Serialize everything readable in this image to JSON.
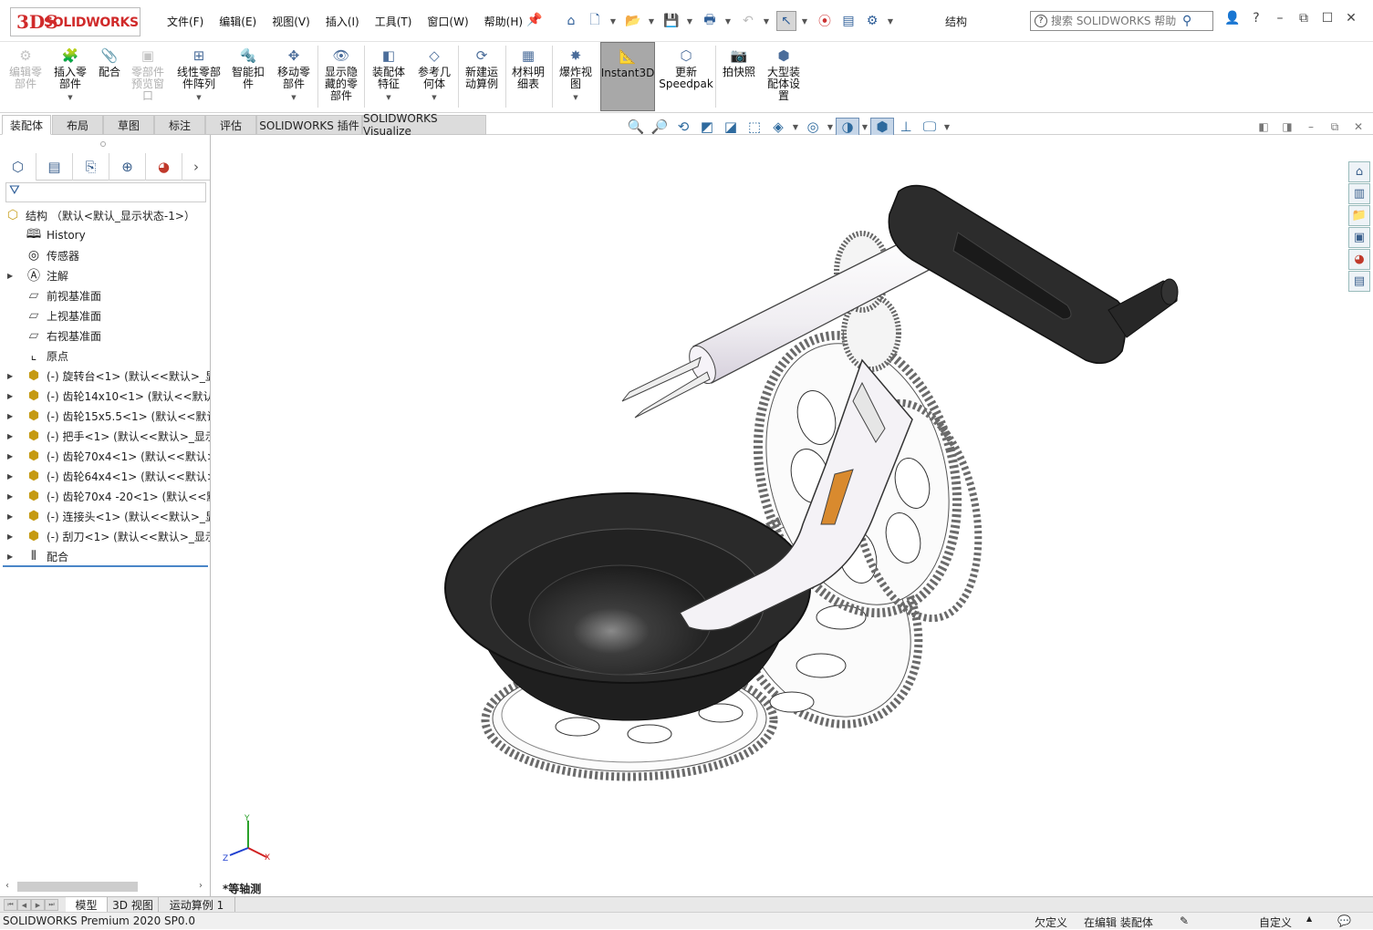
{
  "app": {
    "logo_ds": "3DS",
    "logo_text": "SOLIDWORKS",
    "doc_title": "结构"
  },
  "menu": [
    "文件(F)",
    "编辑(E)",
    "视图(V)",
    "插入(I)",
    "工具(T)",
    "窗口(W)",
    "帮助(H)"
  ],
  "help_search": {
    "placeholder": "搜索 SOLIDWORKS 帮助"
  },
  "ribbon": {
    "edit_component": "编辑零\n部件",
    "insert_components": "插入零\n部件",
    "mate": "配合",
    "component_preview": "零部件\n预览窗\n口",
    "linear_pattern": "线性零部\n件阵列",
    "smart_fasteners": "智能扣\n件",
    "move_component": "移动零\n部件",
    "show_hidden": "显示隐\n藏的零\n部件",
    "assembly_features": "装配体\n特征",
    "reference_geometry": "参考几\n何体",
    "new_motion_study": "新建运\n动算例",
    "bom": "材料明\n细表",
    "exploded_view": "爆炸视\n图",
    "instant3d": "Instant3D",
    "update_speedpak": "更新\nSpeedpak",
    "take_snapshot": "拍快照",
    "large_assembly": "大型装\n配体设\n置"
  },
  "command_tabs": [
    "装配体",
    "布局",
    "草图",
    "标注",
    "评估",
    "SOLIDWORKS 插件",
    "SOLIDWORKS Visualize"
  ],
  "feature_tree": {
    "root": "结构 （默认<默认_显示状态-1>）",
    "items": [
      {
        "label": "History",
        "icon": "history-icon",
        "expand": false
      },
      {
        "label": "传感器",
        "icon": "sensor-icon",
        "expand": false
      },
      {
        "label": "注解",
        "icon": "annotation-icon",
        "expand": true
      },
      {
        "label": "前视基准面",
        "icon": "plane-icon",
        "expand": false
      },
      {
        "label": "上视基准面",
        "icon": "plane-icon",
        "expand": false
      },
      {
        "label": "右视基准面",
        "icon": "plane-icon",
        "expand": false
      },
      {
        "label": "原点",
        "icon": "origin-icon",
        "expand": false
      },
      {
        "label": "(-) 旋转台<1> (默认<<默认>_显",
        "icon": "part-icon",
        "expand": true
      },
      {
        "label": "(-) 齿轮14x10<1> (默认<<默认>",
        "icon": "part-icon",
        "expand": true
      },
      {
        "label": "(-) 齿轮15x5.5<1> (默认<<默认",
        "icon": "part-icon",
        "expand": true
      },
      {
        "label": "(-) 把手<1> (默认<<默认>_显示",
        "icon": "part-icon",
        "expand": true
      },
      {
        "label": "(-) 齿轮70x4<1> (默认<<默认>",
        "icon": "part-icon",
        "expand": true
      },
      {
        "label": "(-) 齿轮64x4<1> (默认<<默认>",
        "icon": "part-icon",
        "expand": true
      },
      {
        "label": "(-) 齿轮70x4 -20<1> (默认<<默",
        "icon": "part-icon",
        "expand": true
      },
      {
        "label": "(-) 连接头<1> (默认<<默认>_显",
        "icon": "part-icon",
        "expand": true
      },
      {
        "label": "(-) 刮刀<1> (默认<<默认>_显示",
        "icon": "part-icon",
        "expand": true
      },
      {
        "label": "配合",
        "icon": "mates-icon",
        "expand": true
      }
    ]
  },
  "viewport": {
    "view_name": "*等轴测",
    "triad": {
      "x": "X",
      "y": "Y",
      "z": "Z"
    }
  },
  "bottom_tabs": [
    "模型",
    "3D 视图",
    "运动算例 1"
  ],
  "status": {
    "product": "SOLIDWORKS Premium 2020 SP0.0",
    "definition": "欠定义",
    "editing": "在编辑 装配体",
    "units": "自定义"
  }
}
